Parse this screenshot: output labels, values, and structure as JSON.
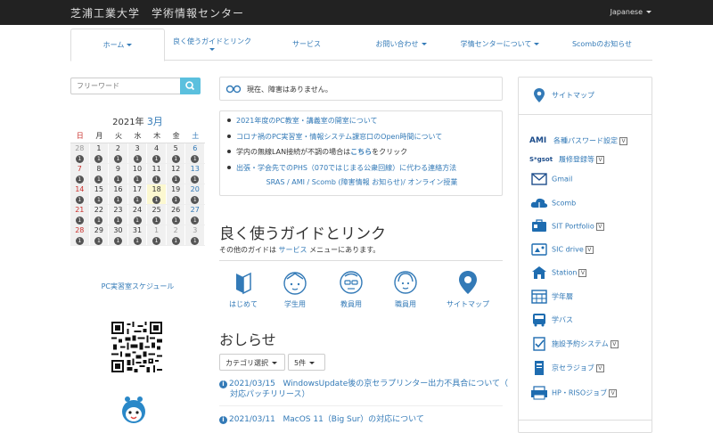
{
  "header": {
    "title": "芝浦工業大学　学術情報センター",
    "language": "Japanese"
  },
  "nav": {
    "items": [
      {
        "label": "ホーム"
      },
      {
        "label": "良く使うガイドとリンク"
      },
      {
        "label": "サービス"
      },
      {
        "label": "お問い合わせ"
      },
      {
        "label": "学情センターについて"
      },
      {
        "label": "Scombのお知らせ"
      }
    ]
  },
  "search": {
    "placeholder": "フリーワード"
  },
  "calendar": {
    "year": "2021年",
    "month": "3月",
    "weekdays": [
      "日",
      "月",
      "火",
      "水",
      "木",
      "金",
      "土"
    ],
    "weeks": [
      [
        "28",
        "1",
        "2",
        "3",
        "4",
        "5",
        "6"
      ],
      [
        "7",
        "8",
        "9",
        "10",
        "11",
        "12",
        "13"
      ],
      [
        "14",
        "15",
        "16",
        "17",
        "18",
        "19",
        "20"
      ],
      [
        "21",
        "22",
        "23",
        "24",
        "25",
        "26",
        "27"
      ],
      [
        "28",
        "29",
        "30",
        "31",
        "1",
        "2",
        "3"
      ]
    ],
    "badge": "1",
    "link": "PC実習室スケジュール"
  },
  "status": {
    "text": "現在、障害はありません。"
  },
  "notices": {
    "items": [
      "2021年度のPC教室・講義室の開室について",
      "コロナ禍のPC実習室・情報システム課窓口のOpen時間について",
      "学内の無線LAN接続が不調の場合は",
      "こちら",
      "をクリック",
      "出張・学会先でのPHS（070ではじまる公衆回線）に代わる連絡方法"
    ],
    "online": "SRAS / AMI / Scomb (障害情報 お知らせ)/ オンライン授業"
  },
  "guide": {
    "title": "良く使うガイドとリンク",
    "sub_prefix": "その他のガイドは",
    "sub_link": "サービス",
    "sub_suffix": "メニューにあります。",
    "items": [
      "はじめて",
      "学生用",
      "教員用",
      "職員用",
      "サイトマップ"
    ]
  },
  "news": {
    "title": "おしらせ",
    "category": "カテゴリ選択",
    "count": "5件",
    "items": [
      {
        "date": "2021/03/15",
        "title": "WindowsUpdate後の京セラプリンター出力不具合について（",
        "title2": "対応パッチリリース）"
      },
      {
        "date": "2021/03/11",
        "title": "MacOS 11（Big Sur）の対応について"
      }
    ]
  },
  "sidebar": {
    "sitemap": "サイトマップ",
    "items": [
      {
        "label": "各種パスワード設定",
        "v": "V",
        "icon_text": "AMI"
      },
      {
        "label": "履修登録等",
        "v": "V",
        "icon_text": "S*gsot"
      },
      {
        "label": "Gmail"
      },
      {
        "label": "Scomb"
      },
      {
        "label": "SIT Portfolio",
        "v": "V"
      },
      {
        "label": "SIC drive",
        "v": "V"
      },
      {
        "label": "Station",
        "v": "V"
      },
      {
        "label": "学年暦"
      },
      {
        "label": "学バス"
      },
      {
        "label": "施設予約システム",
        "v": "V"
      },
      {
        "label": "京セラジョブ",
        "v": "V"
      },
      {
        "label": "HP・RISOジョブ",
        "v": "V"
      }
    ]
  },
  "colors": {
    "link": "#337ab7",
    "topbar": "#222222",
    "search_button": "#5bc0de",
    "today": "#fcf8d0"
  }
}
